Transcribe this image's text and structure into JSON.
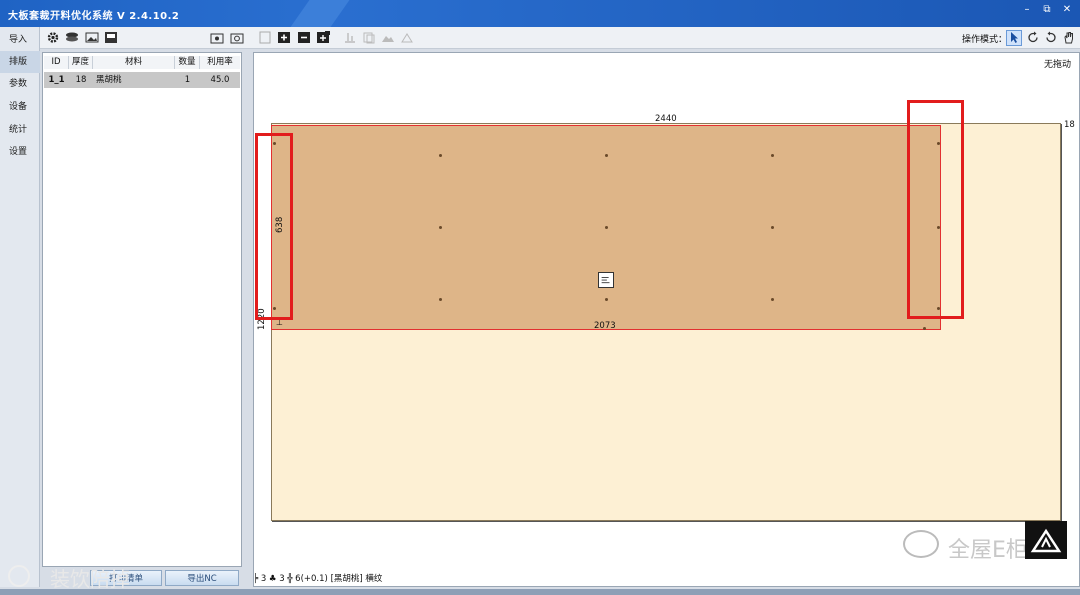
{
  "window": {
    "title": "大板套裁开料优化系统 V 2.4.10.2",
    "min_label": "–",
    "restore_label": "⧉",
    "close_label": "✕"
  },
  "nav": {
    "items": [
      {
        "label": "导入"
      },
      {
        "label": "排版"
      },
      {
        "label": "参数"
      },
      {
        "label": "设备"
      },
      {
        "label": "统计"
      },
      {
        "label": "设置"
      }
    ]
  },
  "toolbar": {
    "mode_label": "操作模式："
  },
  "part_list": {
    "columns": [
      "ID",
      "厚度",
      "材料",
      "数量",
      "利用率"
    ],
    "rows": [
      {
        "id": "1_1",
        "thickness": "18",
        "material": "黑胡桃",
        "qty": "1",
        "utilization": "45.0"
      }
    ]
  },
  "buttons": {
    "export_list": "打印清单",
    "export_nc": "导出NC"
  },
  "canvas": {
    "drag_status": "无拖动",
    "board_width": "2440",
    "board_height": "1220",
    "board_thickness": "18",
    "part_height": "638",
    "part_inner_width": "2073"
  },
  "status": {
    "text": "╞ 3 ♣ 3  ╬ 6(+0.1)   [黑胡桃]  横纹"
  },
  "watermark": {
    "left_text": "装饮陪掉",
    "right_text": "全屋E柜"
  },
  "colors": {
    "title_bar": "#1f63c4",
    "board_fill": "#fdf0d4",
    "part_fill": "#deb588",
    "highlight": "#e21c1c"
  }
}
